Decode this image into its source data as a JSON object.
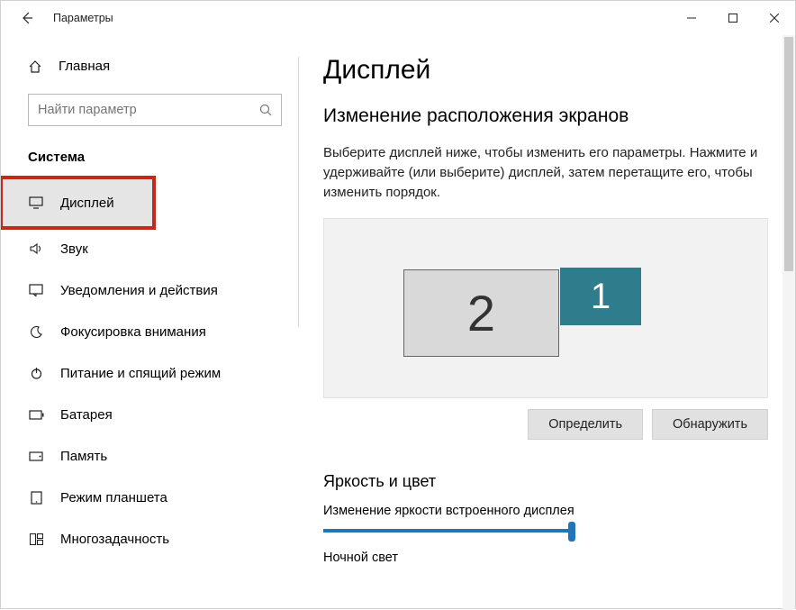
{
  "window": {
    "title": "Параметры"
  },
  "sidebar": {
    "home": "Главная",
    "search_placeholder": "Найти параметр",
    "category": "Система",
    "items": [
      {
        "label": "Дисплей"
      },
      {
        "label": "Звук"
      },
      {
        "label": "Уведомления и действия"
      },
      {
        "label": "Фокусировка внимания"
      },
      {
        "label": "Питание и спящий режим"
      },
      {
        "label": "Батарея"
      },
      {
        "label": "Память"
      },
      {
        "label": "Режим планшета"
      },
      {
        "label": "Многозадачность"
      }
    ]
  },
  "main": {
    "page_title": "Дисплей",
    "arrange_title": "Изменение расположения экранов",
    "arrange_desc": "Выберите дисплей ниже, чтобы изменить его параметры. Нажмите и удерживайте (или выберите) дисплей, затем перетащите его, чтобы изменить порядок.",
    "monitor_1": "1",
    "monitor_2": "2",
    "btn_identify": "Определить",
    "btn_detect": "Обнаружить",
    "brightness_title": "Яркость и цвет",
    "brightness_label": "Изменение яркости встроенного дисплея",
    "night_light": "Ночной свет"
  }
}
